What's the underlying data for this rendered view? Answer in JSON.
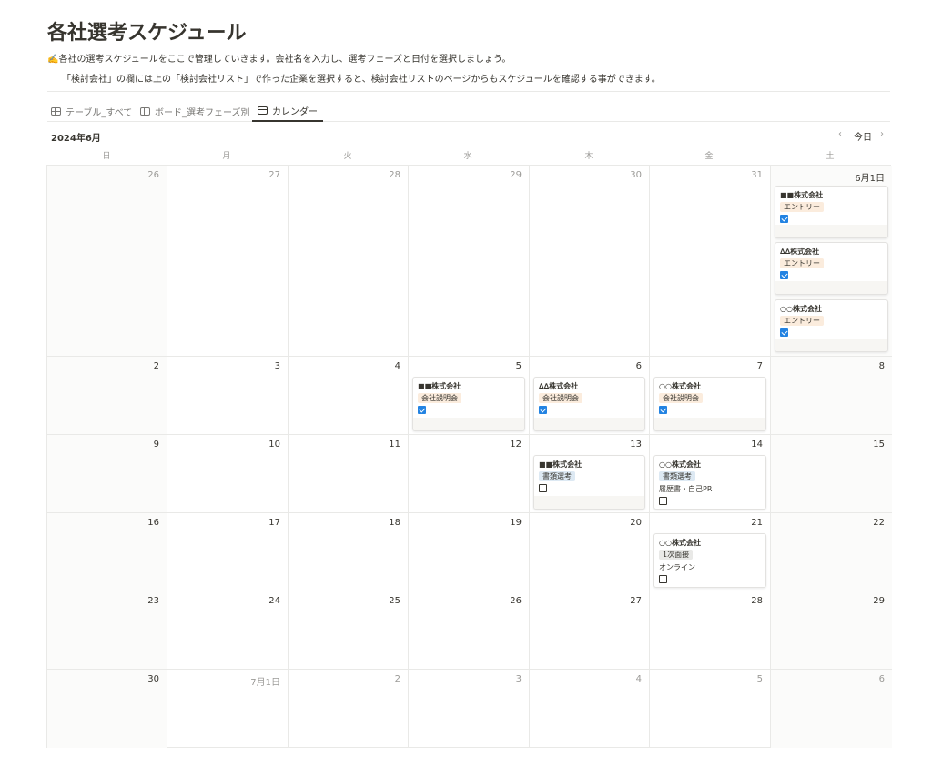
{
  "page": {
    "title": "各社選考スケジュール",
    "desc1": "✍️各社の選考スケジュールをここで管理していきます。会社名を入力し、選考フェーズと日付を選択しましょう。",
    "desc2": "「検討会社」の欄には上の「検討会社リスト」で作った企業を選択すると、検討会社リストのページからもスケジュールを確認する事ができます。"
  },
  "tabs": [
    {
      "label": "テーブル_すべて",
      "icon": "table-icon",
      "active": false
    },
    {
      "label": "ボード_選考フェーズ別",
      "icon": "board-icon",
      "active": false
    },
    {
      "label": "カレンダー",
      "icon": "calendar-icon",
      "active": true
    }
  ],
  "calendar": {
    "month_label": "2024年6月",
    "prev": "‹",
    "today": "今日",
    "next": "›",
    "weekdays": [
      "日",
      "月",
      "火",
      "水",
      "木",
      "金",
      "土"
    ],
    "weeks": [
      [
        "26",
        "27",
        "28",
        "29",
        "30",
        "31",
        "6月1日"
      ],
      [
        "2",
        "3",
        "4",
        "5",
        "6",
        "7",
        "8"
      ],
      [
        "9",
        "10",
        "11",
        "12",
        "13",
        "14",
        "15"
      ],
      [
        "16",
        "17",
        "18",
        "19",
        "20",
        "21",
        "22"
      ],
      [
        "23",
        "24",
        "25",
        "26",
        "27",
        "28",
        "29"
      ],
      [
        "30",
        "7月1日",
        "2",
        "3",
        "4",
        "5",
        "6"
      ]
    ],
    "other_month": [
      [
        true,
        true,
        true,
        true,
        true,
        true,
        false
      ],
      [
        false,
        false,
        false,
        false,
        false,
        false,
        false
      ],
      [
        false,
        false,
        false,
        false,
        false,
        false,
        false
      ],
      [
        false,
        false,
        false,
        false,
        false,
        false,
        false
      ],
      [
        false,
        false,
        false,
        false,
        false,
        false,
        false
      ],
      [
        false,
        true,
        true,
        true,
        true,
        true,
        true
      ]
    ],
    "events": [
      {
        "week": 0,
        "day": 6,
        "slot": 0,
        "company": "■■株式会社",
        "phase": "エントリー",
        "tag_color": "orange",
        "note": "",
        "checked": true
      },
      {
        "week": 0,
        "day": 6,
        "slot": 1,
        "company": "∆∆株式会社",
        "phase": "エントリー",
        "tag_color": "orange",
        "note": "",
        "checked": true
      },
      {
        "week": 0,
        "day": 6,
        "slot": 2,
        "company": "○○株式会社",
        "phase": "エントリー",
        "tag_color": "orange",
        "note": "",
        "checked": true
      },
      {
        "week": 1,
        "day": 3,
        "slot": 0,
        "company": "■■株式会社",
        "phase": "会社説明会",
        "tag_color": "orange",
        "note": "",
        "checked": true
      },
      {
        "week": 1,
        "day": 4,
        "slot": 0,
        "company": "∆∆株式会社",
        "phase": "会社説明会",
        "tag_color": "orange",
        "note": "",
        "checked": true
      },
      {
        "week": 1,
        "day": 5,
        "slot": 0,
        "company": "○○株式会社",
        "phase": "会社説明会",
        "tag_color": "orange",
        "note": "",
        "checked": true
      },
      {
        "week": 2,
        "day": 4,
        "slot": 0,
        "company": "■■株式会社",
        "phase": "書類選考",
        "tag_color": "blue",
        "note": "",
        "checked": false
      },
      {
        "week": 2,
        "day": 5,
        "slot": 0,
        "company": "○○株式会社",
        "phase": "書類選考",
        "tag_color": "blue",
        "note": "履歴書・自己PR",
        "checked": false
      },
      {
        "week": 3,
        "day": 5,
        "slot": 0,
        "company": "○○株式会社",
        "phase": "1次面接",
        "tag_color": "gray",
        "note": "オンライン",
        "checked": false
      }
    ]
  }
}
